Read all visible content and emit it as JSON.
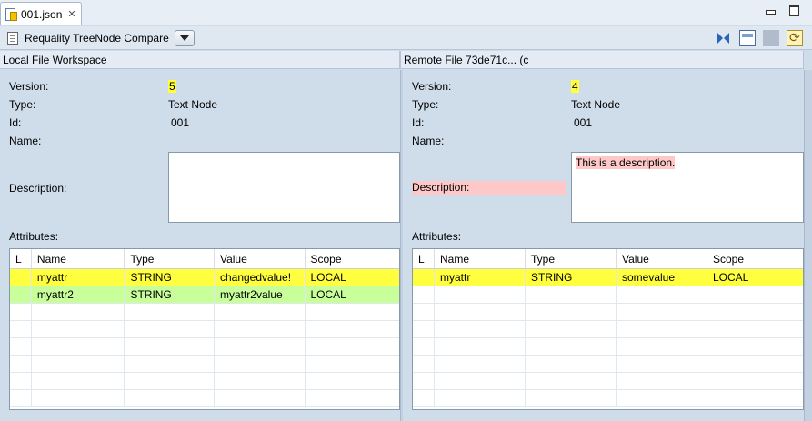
{
  "tab": {
    "title": "001.json",
    "close_glyph": "✕"
  },
  "toolbar": {
    "compare_label": "Requality TreeNode Compare"
  },
  "left": {
    "header": "Local File Workspace",
    "fields": {
      "version_label": "Version:",
      "version_value": "5",
      "type_label": "Type:",
      "type_value": "Text Node",
      "id_label": "Id:",
      "id_value": "001",
      "name_label": "Name:",
      "name_value": "",
      "description_label": "Description:",
      "description_value": ""
    },
    "attributes_label": "Attributes:",
    "columns": [
      "L",
      "Name",
      "Type",
      "Value",
      "Scope"
    ],
    "rows": [
      {
        "l": "",
        "name": "myattr",
        "type": "STRING",
        "value": "changedvalue!",
        "scope": "LOCAL",
        "status": "changed"
      },
      {
        "l": "",
        "name": "myattr2",
        "type": "STRING",
        "value": "myattr2value",
        "scope": "LOCAL",
        "status": "added"
      }
    ]
  },
  "right": {
    "header": "Remote File 73de71c... (c",
    "fields": {
      "version_label": "Version:",
      "version_value": "4",
      "type_label": "Type:",
      "type_value": "Text Node",
      "id_label": "Id:",
      "id_value": "001",
      "name_label": "Name:",
      "name_value": "",
      "description_label": "Description:",
      "description_value": "This is a description."
    },
    "attributes_label": "Attributes:",
    "columns": [
      "L",
      "Name",
      "Type",
      "Value",
      "Scope"
    ],
    "rows": [
      {
        "l": "",
        "name": "myattr",
        "type": "STRING",
        "value": "somevalue",
        "scope": "LOCAL",
        "status": "changed"
      }
    ]
  },
  "colors": {
    "changed": "#ffff40",
    "added": "#c8ff9a",
    "removed": "#ffc8c8"
  },
  "icons": [
    "json-file-icon",
    "close-icon",
    "minimize-icon",
    "maximize-icon",
    "document-icon",
    "dropdown-arrow-icon",
    "merge-icon",
    "layout-icon",
    "sync-icon"
  ]
}
